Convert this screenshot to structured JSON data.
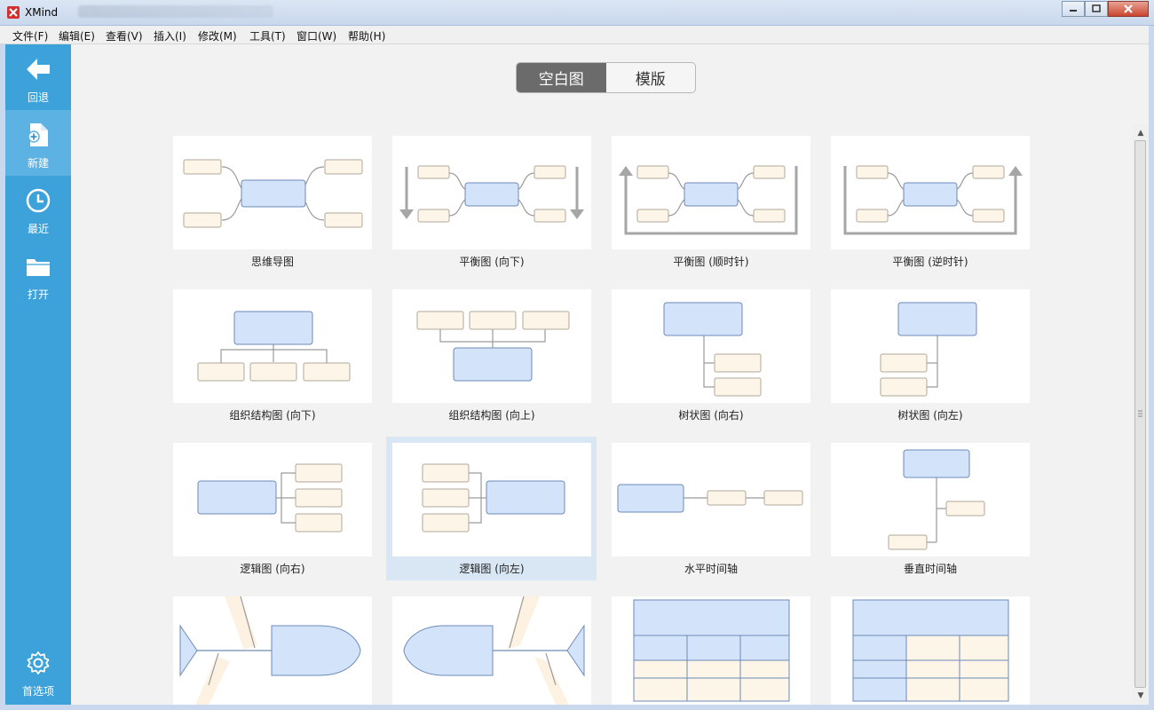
{
  "window": {
    "title": "XMind"
  },
  "menu": [
    {
      "label": "文件(F)"
    },
    {
      "label": "编辑(E)"
    },
    {
      "label": "查看(V)"
    },
    {
      "label": "插入(I)"
    },
    {
      "label": "修改(M)"
    },
    {
      "label": "工具(T)"
    },
    {
      "label": "窗口(W)"
    },
    {
      "label": "帮助(H)"
    }
  ],
  "sidebar": {
    "items": [
      {
        "label": "回退",
        "icon": "back-arrow-icon"
      },
      {
        "label": "新建",
        "icon": "new-file-icon",
        "active": true
      },
      {
        "label": "最近",
        "icon": "clock-icon"
      },
      {
        "label": "打开",
        "icon": "folder-icon"
      }
    ],
    "settings": {
      "label": "首选项",
      "icon": "gear-icon"
    }
  },
  "tabs": [
    {
      "label": "空白图",
      "active": true
    },
    {
      "label": "模版",
      "active": false
    }
  ],
  "templates": [
    {
      "label": "思维导图",
      "diagram": "mind-map"
    },
    {
      "label": "平衡图 (向下)",
      "diagram": "balance-down"
    },
    {
      "label": "平衡图 (顺时针)",
      "diagram": "balance-clockwise"
    },
    {
      "label": "平衡图 (逆时针)",
      "diagram": "balance-anticlockwise"
    },
    {
      "label": "组织结构图 (向下)",
      "diagram": "org-chart-down"
    },
    {
      "label": "组织结构图 (向上)",
      "diagram": "org-chart-up"
    },
    {
      "label": "树状图 (向右)",
      "diagram": "tree-right"
    },
    {
      "label": "树状图 (向左)",
      "diagram": "tree-left"
    },
    {
      "label": "逻辑图 (向右)",
      "diagram": "logic-right"
    },
    {
      "label": "逻辑图 (向左)",
      "diagram": "logic-left",
      "selected": true
    },
    {
      "label": "水平时间轴",
      "diagram": "timeline-horizontal"
    },
    {
      "label": "垂直时间轴",
      "diagram": "timeline-vertical"
    },
    {
      "label": "",
      "diagram": "fishbone-right"
    },
    {
      "label": "",
      "diagram": "fishbone-left"
    },
    {
      "label": "",
      "diagram": "matrix-column"
    },
    {
      "label": "",
      "diagram": "matrix-row"
    }
  ],
  "colors": {
    "sidebar": "#3da1da",
    "sidebar_active": "#5cb3e3",
    "topic_fill": "#d3e3fa",
    "topic_stroke": "#6c8bb8",
    "subtopic_fill": "#fdf5e8",
    "subtopic_stroke": "#b0a89a",
    "selected_card": "#d9e7f4"
  }
}
